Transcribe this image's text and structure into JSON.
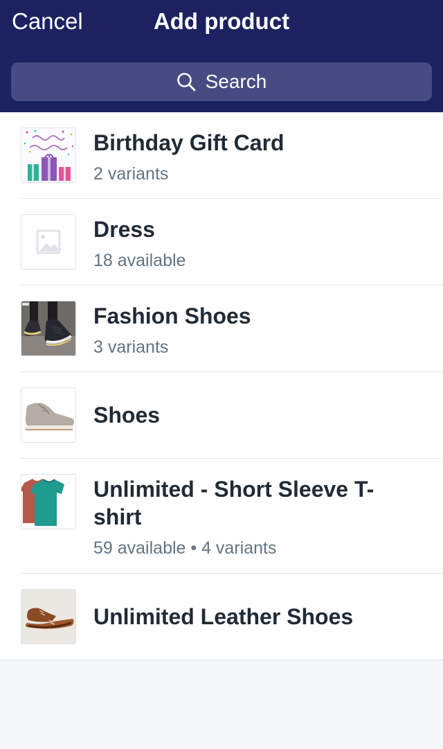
{
  "nav": {
    "cancel_label": "Cancel",
    "title": "Add product"
  },
  "search": {
    "placeholder": "Search",
    "icon": "search-icon"
  },
  "products": [
    {
      "title": "Birthday Gift Card",
      "subtitle": "2 variants",
      "thumbnail": "birthday-gift-card-image"
    },
    {
      "title": "Dress",
      "subtitle": "18 available",
      "thumbnail": "image-placeholder-icon"
    },
    {
      "title": "Fashion Shoes",
      "subtitle": "3 variants",
      "thumbnail": "fashion-shoes-image"
    },
    {
      "title": "Shoes",
      "subtitle": "",
      "thumbnail": "shoes-image"
    },
    {
      "title": "Unlimited - Short Sleeve T-shirt",
      "subtitle": "59 available • 4 variants",
      "thumbnail": "tshirt-image"
    },
    {
      "title": "Unlimited Leather Shoes",
      "subtitle": "",
      "thumbnail": "leather-shoes-image"
    }
  ],
  "colors": {
    "nav_background": "#1c2260",
    "search_background": "#474b82",
    "title_text": "#212b36",
    "subtitle_text": "#637381",
    "page_background": "#f4f6f8"
  }
}
